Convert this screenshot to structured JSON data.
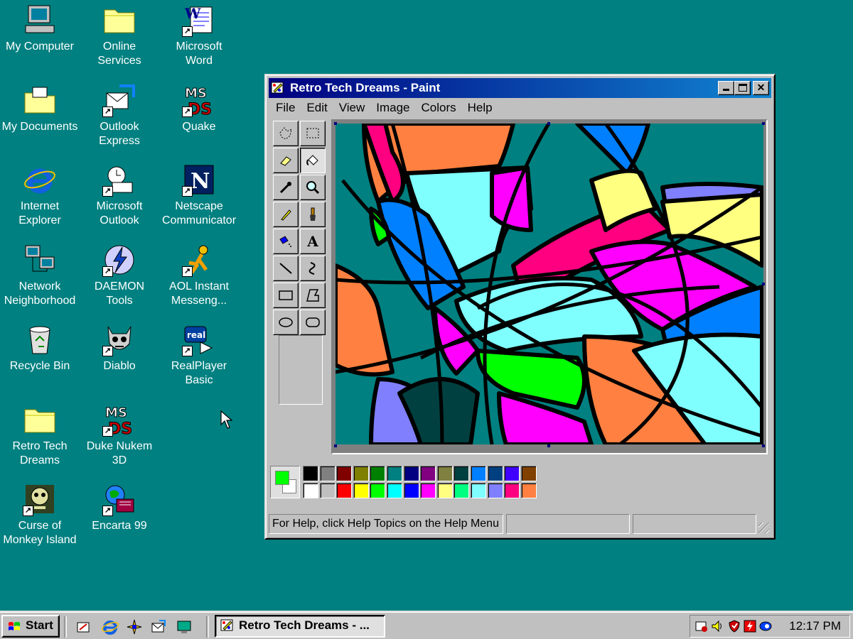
{
  "desktop": {
    "icons": [
      {
        "label": "My Computer",
        "icon": "my-computer-icon"
      },
      {
        "label": "Online\nServices",
        "icon": "folder-icon"
      },
      {
        "label": "Microsoft\nWord",
        "icon": "word-icon"
      },
      {
        "label": "My Documents",
        "icon": "my-documents-icon"
      },
      {
        "label": "Outlook\nExpress",
        "icon": "outlook-express-icon"
      },
      {
        "label": "Quake",
        "icon": "quake-icon"
      },
      {
        "label": "Internet\nExplorer",
        "icon": "internet-explorer-icon"
      },
      {
        "label": "Microsoft\nOutlook",
        "icon": "outlook-icon"
      },
      {
        "label": "Netscape\nCommunicator",
        "icon": "netscape-icon"
      },
      {
        "label": "Network\nNeighborhood",
        "icon": "network-icon"
      },
      {
        "label": "DAEMON\nTools",
        "icon": "daemon-tools-icon"
      },
      {
        "label": "AOL Instant\nMesseng...",
        "icon": "aim-icon"
      },
      {
        "label": "Recycle Bin",
        "icon": "recycle-bin-icon"
      },
      {
        "label": "Diablo",
        "icon": "diablo-icon"
      },
      {
        "label": "RealPlayer\nBasic",
        "icon": "realplayer-icon"
      },
      {
        "label": "Retro Tech\nDreams",
        "icon": "folder-icon"
      },
      {
        "label": "Duke Nukem\n3D",
        "icon": "duke-nukem-icon"
      },
      {
        "label": "Curse of\nMonkey Island",
        "icon": "monkey-island-icon"
      },
      {
        "label": "Encarta 99",
        "icon": "encarta-icon"
      }
    ]
  },
  "paint": {
    "title": "Retro Tech Dreams - Paint",
    "menu": [
      "File",
      "Edit",
      "View",
      "Image",
      "Colors",
      "Help"
    ],
    "status_text": "For Help, click Help Topics on the Help Menu",
    "foreground_color": "#00ff00",
    "background_color": "#ffffff",
    "palette_top": [
      "#000000",
      "#808080",
      "#800000",
      "#808000",
      "#008000",
      "#008080",
      "#000080",
      "#800080",
      "#808040",
      "#004040",
      "#0080ff",
      "#004080",
      "#4000ff",
      "#804000"
    ],
    "palette_bottom": [
      "#ffffff",
      "#c0c0c0",
      "#ff0000",
      "#ffff00",
      "#00ff00",
      "#00ffff",
      "#0000ff",
      "#ff00ff",
      "#ffff80",
      "#00ff80",
      "#80ffff",
      "#8080ff",
      "#ff0080",
      "#ff8040"
    ]
  },
  "taskbar": {
    "start_label": "Start",
    "task_label": "Retro Tech Dreams - ...",
    "clock": "12:17 PM"
  }
}
